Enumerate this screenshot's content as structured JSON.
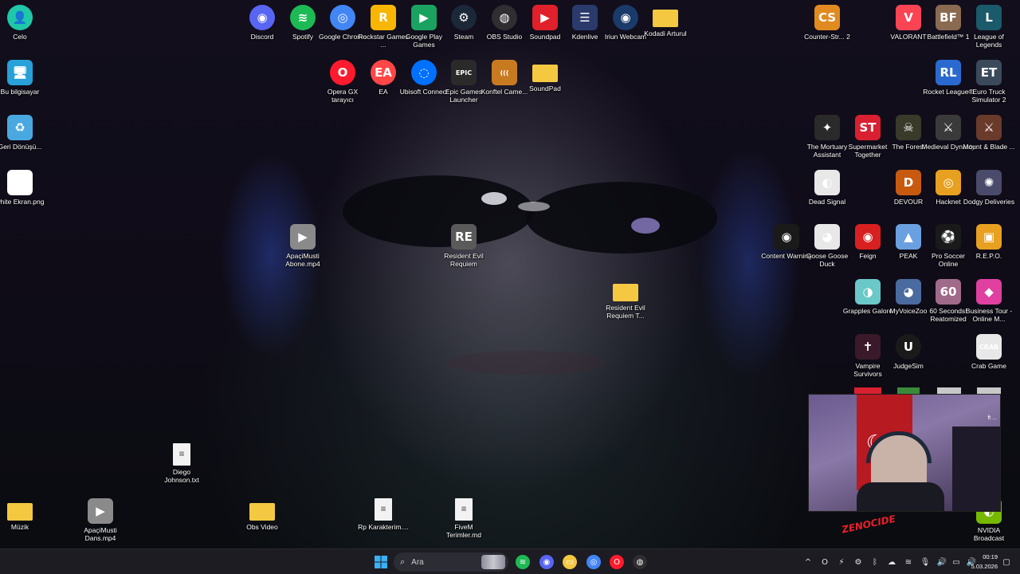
{
  "colors": {
    "discord": "#5865F2",
    "spotify": "#1DB954",
    "chrome": "#4285F4",
    "rockstar": "#F8B600",
    "steam": "#1b2838",
    "obs": "#302e31",
    "soundpad": "#e0202a",
    "kdenlive": "#2a3a6a",
    "folder": "#f5c842",
    "opera": "#ff1b2d",
    "ea": "#ff4747",
    "ubisoft": "#0070ff",
    "epic": "#2a2a2a"
  },
  "desktop_icons": [
    {
      "id": "celo",
      "label": "Celo",
      "icon": "user-icon",
      "glyph": "👤",
      "bg": "#1ec8a8"
    },
    {
      "id": "bu-bilgisayar",
      "label": "Bu bilgisayar",
      "icon": "computer-icon",
      "glyph": "🖥",
      "bg": "#28a0d8"
    },
    {
      "id": "geri-donusum",
      "label": "Geri Dönüşü...",
      "icon": "recycle-bin-icon",
      "glyph": "♻",
      "bg": "#4aa8e0"
    },
    {
      "id": "white-ekran",
      "label": "white Ekran.png",
      "icon": "image-file-icon",
      "glyph": "",
      "bg": "#ffffff"
    },
    {
      "id": "discord",
      "label": "Discord",
      "icon": "discord-icon",
      "glyph": "◉",
      "bg": "#5865F2"
    },
    {
      "id": "spotify",
      "label": "Spotify",
      "icon": "spotify-icon",
      "glyph": "≋",
      "bg": "#1DB954"
    },
    {
      "id": "google-chrome",
      "label": "Google Chrome",
      "icon": "chrome-icon",
      "glyph": "◎",
      "bg": "#4285F4"
    },
    {
      "id": "rockstar",
      "label": "Rockstar Games ...",
      "icon": "rockstar-icon",
      "glyph": "R",
      "bg": "#F8B600"
    },
    {
      "id": "google-play-games",
      "label": "Google Play Games",
      "icon": "play-games-icon",
      "glyph": "▶",
      "bg": "#1aa260"
    },
    {
      "id": "steam",
      "label": "Steam",
      "icon": "steam-icon",
      "glyph": "⚙",
      "bg": "#1b2838"
    },
    {
      "id": "obs-studio",
      "label": "OBS Studio",
      "icon": "obs-icon",
      "glyph": "◍",
      "bg": "#302e31"
    },
    {
      "id": "soundpad",
      "label": "Soundpad",
      "icon": "soundpad-icon",
      "glyph": "▶",
      "bg": "#e0202a"
    },
    {
      "id": "kdenlive",
      "label": "Kdenlive",
      "icon": "kdenlive-icon",
      "glyph": "☰",
      "bg": "#2a3a6a"
    },
    {
      "id": "iriun-webcam",
      "label": "Iriun Webcam",
      "icon": "webcam-icon",
      "glyph": "◉",
      "bg": "#1a3a6a"
    },
    {
      "id": "kodadi-arturul",
      "label": "Kodadi Arturul",
      "icon": "folder-icon",
      "glyph": "",
      "bg": "#f5c842"
    },
    {
      "id": "opera-gx",
      "label": "Opera GX tarayıcı",
      "icon": "opera-gx-icon",
      "glyph": "O",
      "bg": "#ff1b2d"
    },
    {
      "id": "ea",
      "label": "EA",
      "icon": "ea-icon",
      "glyph": "EA",
      "bg": "#ff4747"
    },
    {
      "id": "ubisoft-connect",
      "label": "Ubisoft Connect",
      "icon": "ubisoft-icon",
      "glyph": "◌",
      "bg": "#0070ff"
    },
    {
      "id": "epic-games",
      "label": "Epic Games Launcher",
      "icon": "epic-games-icon",
      "glyph": "EPIC",
      "bg": "#2a2a2a"
    },
    {
      "id": "konftel",
      "label": "Konftel Came...",
      "icon": "konftel-icon",
      "glyph": "(((",
      "bg": "#c87a20"
    },
    {
      "id": "soundpad-folder",
      "label": "SoundPad",
      "icon": "folder-icon",
      "glyph": "",
      "bg": "#f5c842"
    },
    {
      "id": "counter-strike",
      "label": "Counter-Str... 2",
      "icon": "counter-strike-icon",
      "glyph": "CS",
      "bg": "#e08a20"
    },
    {
      "id": "valorant",
      "label": "VALORANT",
      "icon": "valorant-icon",
      "glyph": "V",
      "bg": "#fa4454"
    },
    {
      "id": "battlefield",
      "label": "Battlefield™ 1",
      "icon": "battlefield-icon",
      "glyph": "BF",
      "bg": "#8a6a50"
    },
    {
      "id": "league-of-legends",
      "label": "League of Legends",
      "icon": "league-icon",
      "glyph": "L",
      "bg": "#1a5a6a"
    },
    {
      "id": "rocket-league",
      "label": "Rocket League®",
      "icon": "rocket-league-icon",
      "glyph": "RL",
      "bg": "#2a6ad0"
    },
    {
      "id": "euro-truck",
      "label": "Euro Truck Simulator 2",
      "icon": "euro-truck-icon",
      "glyph": "ET",
      "bg": "#3a4a5a"
    },
    {
      "id": "mortuary-assistant",
      "label": "The Mortuary Assistant",
      "icon": "mortuary-icon",
      "glyph": "✦",
      "bg": "#2a2a2a"
    },
    {
      "id": "supermarket-together",
      "label": "Supermarket Together",
      "icon": "supermarket-icon",
      "glyph": "ST",
      "bg": "#d82030"
    },
    {
      "id": "the-forest",
      "label": "The Forest",
      "icon": "forest-icon",
      "glyph": "☠",
      "bg": "#3a3a2a"
    },
    {
      "id": "medieval-dynasty",
      "label": "Medieval Dynasty",
      "icon": "medieval-dynasty-icon",
      "glyph": "⚔",
      "bg": "#3a3a3a"
    },
    {
      "id": "mount-blade",
      "label": "Mount & Blade ...",
      "icon": "mount-blade-icon",
      "glyph": "⚔",
      "bg": "#6a3a2a"
    },
    {
      "id": "dead-signal",
      "label": "Dead Signal",
      "icon": "dead-signal-icon",
      "glyph": "◐",
      "bg": "#e8e8e8"
    },
    {
      "id": "devour",
      "label": "DEVOUR",
      "icon": "devour-icon",
      "glyph": "D",
      "bg": "#c85a10"
    },
    {
      "id": "hacknet",
      "label": "Hacknet",
      "icon": "hacknet-icon",
      "glyph": "◎",
      "bg": "#e8a020"
    },
    {
      "id": "dodgy-deliveries",
      "label": "Dodgy Deliveries",
      "icon": "dodgy-icon",
      "glyph": "✺",
      "bg": "#4a4a6a"
    },
    {
      "id": "content-warning",
      "label": "Content Warning",
      "icon": "content-warning-icon",
      "glyph": "◉",
      "bg": "#1a1a1a"
    },
    {
      "id": "goose-goose-duck",
      "label": "Goose Goose Duck",
      "icon": "goose-icon",
      "glyph": "◕",
      "bg": "#e8e8e8"
    },
    {
      "id": "feign",
      "label": "Feign",
      "icon": "feign-icon",
      "glyph": "◉",
      "bg": "#d82020"
    },
    {
      "id": "peak",
      "label": "PEAK",
      "icon": "peak-icon",
      "glyph": "▲",
      "bg": "#6aa0e0"
    },
    {
      "id": "pro-soccer-online",
      "label": "Pro Soccer Online",
      "icon": "pro-soccer-icon",
      "glyph": "⚽",
      "bg": "#1a1a1a"
    },
    {
      "id": "repo",
      "label": "R.E.P.O.",
      "icon": "repo-icon",
      "glyph": "▣",
      "bg": "#e8a020"
    },
    {
      "id": "grapples-galore",
      "label": "Grapples Galore",
      "icon": "grapples-icon",
      "glyph": "◑",
      "bg": "#6ac8c8"
    },
    {
      "id": "myvoicezoo",
      "label": "MyVoiceZoo",
      "icon": "myvoicezoo-icon",
      "glyph": "◕",
      "bg": "#4a6aa0"
    },
    {
      "id": "60-seconds",
      "label": "60 Seconds! Reatomized",
      "icon": "60-seconds-icon",
      "glyph": "60",
      "bg": "#a06a8a"
    },
    {
      "id": "business-tour",
      "label": "Business Tour - Online M...",
      "icon": "business-tour-icon",
      "glyph": "◆",
      "bg": "#e040a0"
    },
    {
      "id": "vampire-survivors",
      "label": "Vampire Survivors",
      "icon": "vampire-icon",
      "glyph": "✝",
      "bg": "#3a1a2a"
    },
    {
      "id": "judgesim",
      "label": "JudgeSim",
      "icon": "unreal-icon",
      "glyph": "U",
      "bg": "#1a1a1a"
    },
    {
      "id": "crab-game",
      "label": "Crab Game",
      "icon": "crab-game-icon",
      "glyph": "CRAB",
      "bg": "#e8e8e8"
    },
    {
      "id": "apacimusti-abone",
      "label": "ApaçiMusti Abone.mp4",
      "icon": "video-file-icon",
      "glyph": "▶",
      "bg": "#8a8a8a"
    },
    {
      "id": "resident-evil-requiem",
      "label": "Resident Evil Requiem",
      "icon": "resident-evil-icon",
      "glyph": "RE",
      "bg": "#5a5a5a"
    },
    {
      "id": "resident-evil-requiem-t",
      "label": "Resident Evil Requiem T...",
      "icon": "folder-icon",
      "glyph": "",
      "bg": "#f5c842"
    },
    {
      "id": "diego-johnson",
      "label": "Diego Johnson.txt",
      "icon": "text-file-icon",
      "glyph": "≡",
      "bg": "#f2f2f2"
    },
    {
      "id": "muzik",
      "label": "Müzik",
      "icon": "folder-icon",
      "glyph": "",
      "bg": "#f5c842"
    },
    {
      "id": "apacimusti-dans",
      "label": "ApaçiMusti Dans.mp4",
      "icon": "video-file-icon",
      "glyph": "▶",
      "bg": "#8a8a8a"
    },
    {
      "id": "obs-video",
      "label": "Obs Video",
      "icon": "folder-icon",
      "glyph": "",
      "bg": "#f5c842"
    },
    {
      "id": "rp-karakterim",
      "label": "Rp Karakterim....",
      "icon": "text-file-icon",
      "glyph": "≡",
      "bg": "#f2f2f2"
    },
    {
      "id": "fivem-terimler",
      "label": "FiveM Terimler.md",
      "icon": "text-file-icon",
      "glyph": "≡",
      "bg": "#f2f2f2"
    },
    {
      "id": "nvidia-broadcast",
      "label": "NVIDIA Broadcast",
      "icon": "nvidia-icon",
      "glyph": "◐",
      "bg": "#76b900"
    }
  ],
  "webcam_overlay": {
    "flag_glyph": "☾★",
    "caption": "ft ..."
  },
  "stamp_text": "ZENOCIDE",
  "taskbar": {
    "search_placeholder": "Ara",
    "search_icon": "search-icon",
    "start_icon": "windows-start-icon",
    "pinned": [
      {
        "id": "spotify",
        "icon": "spotify-icon",
        "glyph": "≋",
        "bg": "#1DB954"
      },
      {
        "id": "discord",
        "icon": "discord-icon",
        "glyph": "◉",
        "bg": "#5865F2"
      },
      {
        "id": "file-explorer",
        "icon": "folder-icon",
        "glyph": "▭",
        "bg": "#f5c842"
      },
      {
        "id": "chrome",
        "icon": "chrome-icon",
        "glyph": "◎",
        "bg": "#4285F4"
      },
      {
        "id": "opera-gx",
        "icon": "opera-gx-icon",
        "glyph": "O",
        "bg": "#ff1b2d"
      },
      {
        "id": "obs",
        "icon": "obs-icon",
        "glyph": "◍",
        "bg": "#302e31"
      }
    ],
    "tray": [
      {
        "id": "chevron",
        "icon": "chevron-up-icon",
        "glyph": "^"
      },
      {
        "id": "opera-tray",
        "icon": "opera-gx-icon",
        "glyph": "O"
      },
      {
        "id": "usb",
        "icon": "usb-icon",
        "glyph": "⚡"
      },
      {
        "id": "steam-tray",
        "icon": "steam-icon",
        "glyph": "⚙"
      },
      {
        "id": "bluetooth",
        "icon": "bluetooth-icon",
        "glyph": "ᛒ"
      },
      {
        "id": "cloud",
        "icon": "cloud-icon",
        "glyph": "☁"
      },
      {
        "id": "spotify-tray",
        "icon": "spotify-icon",
        "glyph": "≋"
      },
      {
        "id": "microphone",
        "icon": "microphone-icon",
        "glyph": "🎙"
      },
      {
        "id": "volume-tray",
        "icon": "speaker-icon",
        "glyph": "🔊"
      },
      {
        "id": "network",
        "icon": "network-icon",
        "glyph": "▭"
      },
      {
        "id": "volume",
        "icon": "volume-icon",
        "glyph": "🔊"
      }
    ],
    "time": "00:19",
    "date": "5.03.2026",
    "notification_icon": "notification-icon"
  }
}
